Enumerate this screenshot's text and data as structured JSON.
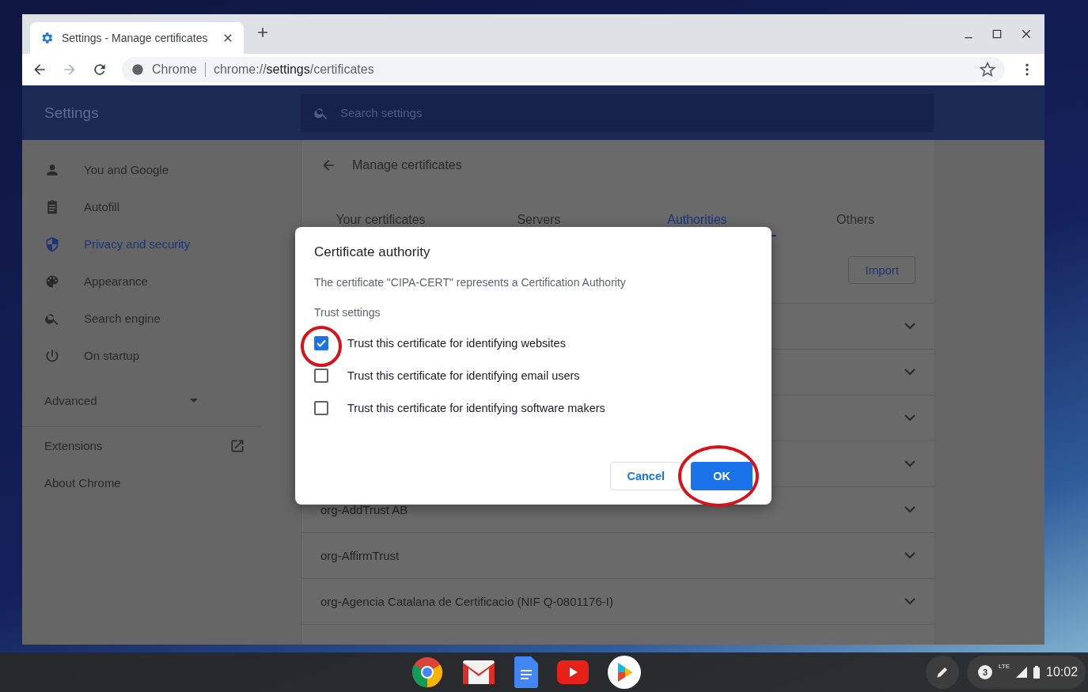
{
  "browser": {
    "tab": {
      "title": "Settings - Manage certificates",
      "selected": true
    },
    "origin": "Chrome",
    "url": "chrome://**settings**/certificates"
  },
  "settings": {
    "title": "Settings",
    "search": {
      "placeholder": "Search settings"
    }
  },
  "sidebar": {
    "items": [
      {
        "label": "You and Google",
        "selected": false
      },
      {
        "label": "Autofill",
        "selected": false
      },
      {
        "label": "Privacy and security",
        "selected": true
      },
      {
        "label": "Appearance",
        "selected": false
      },
      {
        "label": "Search engine",
        "selected": false
      },
      {
        "label": "On startup",
        "selected": false
      }
    ],
    "advanced": {
      "label": "Advanced",
      "expanded": false
    },
    "links": [
      {
        "label": "Extensions",
        "external": true
      },
      {
        "label": "About Chrome",
        "external": false
      }
    ]
  },
  "page": {
    "title": "Manage certificates",
    "tabs": [
      {
        "label": "Your certificates",
        "selected": false
      },
      {
        "label": "Servers",
        "selected": false
      },
      {
        "label": "Authorities",
        "selected": true
      },
      {
        "label": "Others",
        "selected": false
      }
    ],
    "import_button": "Import",
    "rows": [
      {
        "expanded": false
      },
      {
        "expanded": false
      },
      {
        "expanded": false
      },
      {
        "expanded": false
      },
      {
        "name": "org-AddTrust AB",
        "expanded": false
      },
      {
        "name": "org-AffirmTrust",
        "expanded": false
      },
      {
        "name": "org-Agencia Catalana de Certificacio (NIF Q-0801176-I)",
        "expanded": false
      }
    ]
  },
  "dialog": {
    "title": "Certificate authority",
    "message": "The certificate \"CIPA-CERT\" represents a Certification Authority",
    "section": "Trust settings",
    "options": [
      {
        "label": "Trust this certificate for identifying websites",
        "checked": true,
        "highlighted": true
      },
      {
        "label": "Trust this certificate for identifying email users",
        "checked": false,
        "highlighted": false
      },
      {
        "label": "Trust this certificate for identifying software makers",
        "checked": false,
        "highlighted": false
      }
    ],
    "buttons": [
      {
        "label": "Cancel",
        "kind": "secondary",
        "highlighted": false
      },
      {
        "label": "OK",
        "kind": "primary",
        "highlighted": true
      }
    ]
  },
  "shelf": {
    "notifications": "3",
    "network": "LTE",
    "time": "10:02"
  }
}
